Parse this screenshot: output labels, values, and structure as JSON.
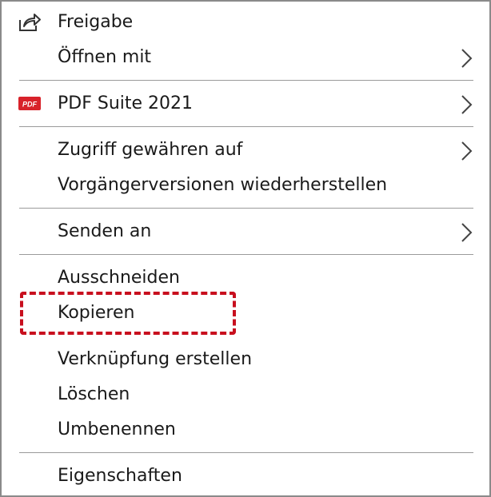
{
  "menu": {
    "items": [
      {
        "label": "Freigabe",
        "icon": "share-icon"
      },
      {
        "label": "Öffnen mit",
        "has_submenu": true
      },
      {
        "label": "PDF Suite 2021",
        "icon": "pdf-icon",
        "icon_text": "PDF",
        "has_submenu": true
      },
      {
        "label": "Zugriff gewähren auf",
        "has_submenu": true
      },
      {
        "label": "Vorgängerversionen wiederherstellen"
      },
      {
        "label": "Senden an",
        "has_submenu": true
      },
      {
        "label": "Ausschneiden"
      },
      {
        "label": "Kopieren",
        "highlighted": true
      },
      {
        "label": "Verknüpfung erstellen"
      },
      {
        "label": "Löschen"
      },
      {
        "label": "Umbenennen"
      },
      {
        "label": "Eigenschaften"
      }
    ]
  },
  "colors": {
    "highlight_border": "#c80f1e",
    "pdf_icon_background": "#d8222a",
    "separator": "#9a9a9a"
  }
}
